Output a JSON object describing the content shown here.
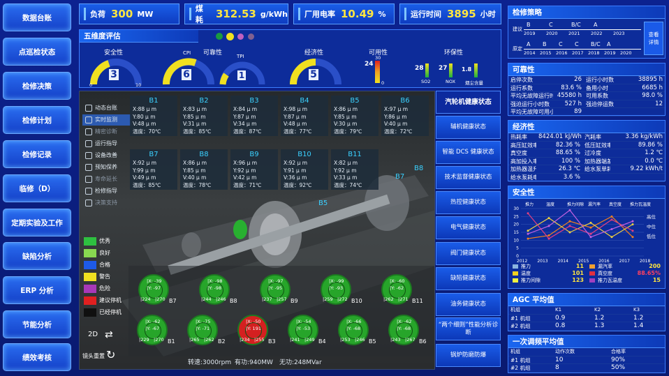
{
  "nav": [
    "数据台账",
    "点巡检状态",
    "检修决策",
    "检修计划",
    "检修记录",
    "临修（D）",
    "定期实验及工作",
    "缺陷分析",
    "ERP 分析",
    "节能分析",
    "绩效考核"
  ],
  "stats": [
    {
      "label": "负荷",
      "value": "300",
      "unit": "MW"
    },
    {
      "label": "煤耗",
      "value": "312.53",
      "unit": "g/kWh"
    },
    {
      "label": "厂用电率",
      "value": "10.49",
      "unit": "%"
    },
    {
      "label": "运行时间",
      "value": "3895",
      "unit": "小时"
    }
  ],
  "five_dim": {
    "title": "五维度评估",
    "safety": "安全性",
    "safety_val": "3",
    "cpi": "CPI",
    "cpi_val": "6",
    "reliab": "可靠性",
    "tpi": "TPI",
    "tpi_val": "1",
    "econ": "经济性",
    "econ_val": "5",
    "avail": "可用性",
    "avail_val": "24",
    "avail_top": "30",
    "avail_bot": "0",
    "env": "环保性",
    "so2_val": "28",
    "so2": "SO2",
    "nox_val": "27",
    "nox": "NOX",
    "dust_val": "1.8",
    "dust": "烟尘含量",
    "g_min": "0",
    "g_max": "10"
  },
  "side_menu": [
    "动态台账",
    "实时监测",
    "精密诊断",
    "运行指导",
    "设备改善",
    "预知保养",
    "寿命延长",
    "检修指导",
    "决策支持"
  ],
  "legend": [
    {
      "label": "优秀",
      "color": "#2ec040"
    },
    {
      "label": "良好",
      "color": "#88d850"
    },
    {
      "label": "合格",
      "color": "#1e5ae8"
    },
    {
      "label": "警告",
      "color": "#f0e020"
    },
    {
      "label": "危险",
      "color": "#a838b8"
    },
    {
      "label": "建议停机",
      "color": "#e02020"
    },
    {
      "label": "已经停机",
      "color": "#101010"
    }
  ],
  "mode": "2D",
  "reset": "镜头重置",
  "bearings": [
    {
      "name": "B1",
      "x": "X:88 μ m",
      "y": "Y:80 μ m",
      "v": "V:48 μ m",
      "t": "温度：70℃"
    },
    {
      "name": "B2",
      "x": "X:83 μ m",
      "y": "Y:85 μ m",
      "v": "V:31 μ m",
      "t": "温度：85℃"
    },
    {
      "name": "B3",
      "x": "X:84 μ m",
      "y": "Y:87 μ m",
      "v": "V:34 μ m",
      "t": "温度：87℃"
    },
    {
      "name": "B4",
      "x": "X:98 μ m",
      "y": "Y:87 μ m",
      "v": "V:48 μ m",
      "t": "温度：77℃"
    },
    {
      "name": "B5",
      "x": "X:86 μ m",
      "y": "Y:85 μ m",
      "v": "V:30 μ m",
      "t": "温度：79℃"
    },
    {
      "name": "B6",
      "x": "X:97 μ m",
      "y": "Y:86 μ m",
      "v": "V:40 μ m",
      "t": "温度：72℃"
    },
    {
      "name": "B7",
      "x": "X:92 μ m",
      "y": "Y:99 μ m",
      "v": "V:49 μ m",
      "t": "温度：85℃"
    },
    {
      "name": "B8",
      "x": "X:86 μ m",
      "y": "Y:85 μ m",
      "v": "V:40 μ m",
      "t": "温度：78℃"
    },
    {
      "name": "B9",
      "x": "X:96 μ m",
      "y": "Y:92 μ m",
      "v": "V:42 μ m",
      "t": "温度：71℃"
    },
    {
      "name": "B10",
      "x": "X:92 μ m",
      "y": "Y:91 μ m",
      "v": "V:36 μ m",
      "t": "温度：92℃"
    },
    {
      "name": "B11",
      "x": "X:82 μ m",
      "y": "Y:92 μ m",
      "v": "V:33 μ m",
      "t": "温度：74℃"
    }
  ],
  "scene_labels": [
    "B5",
    "B7",
    "B8"
  ],
  "gauges": [
    {
      "name": "B7",
      "a": "|X: -39",
      "b": "|Y: -97",
      "c": "|224",
      "d": "|270",
      "color": "#27a52a"
    },
    {
      "name": "B8",
      "a": "|X: -98",
      "b": "|Y: -98",
      "c": "|244",
      "d": "|246",
      "color": "#27a52a"
    },
    {
      "name": "B9",
      "a": "|X: -97",
      "b": "|Y: -95",
      "c": "|237",
      "d": "|257",
      "color": "#27a52a"
    },
    {
      "name": "B10",
      "a": "|X: -99",
      "b": "|Y: -93",
      "c": "|259",
      "d": "|272",
      "color": "#27a52a"
    },
    {
      "name": "B11",
      "a": "|X: -60",
      "b": "|Y: -62",
      "c": "|262",
      "d": "|271",
      "color": "#27a52a"
    },
    {
      "name": "B1",
      "a": "|X: -62",
      "b": "|Y: -67",
      "c": "|229",
      "d": "|270",
      "color": "#27a52a"
    },
    {
      "name": "B2",
      "a": "|X: -75",
      "b": "|Y: -71",
      "c": "|265",
      "d": "|262",
      "color": "#27a52a"
    },
    {
      "name": "B3",
      "a": "|X: -50",
      "b": "|Y: 191",
      "c": "|234",
      "d": "|255",
      "color": "#d42020"
    },
    {
      "name": "B4",
      "a": "|X: -54",
      "b": "|Y: -53",
      "c": "|241",
      "d": "|249",
      "color": "#27a52a"
    },
    {
      "name": "B5",
      "a": "|X: -66",
      "b": "|Y: -68",
      "c": "|253",
      "d": "|246",
      "color": "#27a52a"
    },
    {
      "name": "B6",
      "a": "|X: -62",
      "b": "|Y: -68",
      "c": "|243",
      "d": "|267",
      "color": "#27a52a"
    }
  ],
  "footer": {
    "speed": "转速:3000rpm",
    "active": "有功:940MW",
    "reactive": "无功:248MVar"
  },
  "right_menu": [
    "汽轮机健康状态",
    "辅机健康状态",
    "智能 DCS 健康状态",
    "技术监督健康状态",
    "热控健康状态",
    "电气健康状态",
    "阀门健康状态",
    "缺陷健康状态",
    "油务健康状态",
    "“两个细则”性能分析诊断",
    "锅炉防磨防爆"
  ],
  "strategy": {
    "title": "检修策略",
    "r1_label": "建议",
    "r1_codes": [
      "B",
      "C",
      "B/C",
      "A",
      ""
    ],
    "r1_years": [
      "2019",
      "2020",
      "2021",
      "2022",
      "2023"
    ],
    "r2_label": "原定",
    "r2_codes": [
      "A",
      "B",
      "C",
      "C",
      "B/C",
      "A",
      ""
    ],
    "r2_years": [
      "2014",
      "2015",
      "2016",
      "2017",
      "2018",
      "2019",
      "2020"
    ],
    "btn": "查看详情"
  },
  "reliability": {
    "title": "可靠性",
    "rows": [
      [
        "启停次数",
        "26",
        "运行小时数",
        "38895 h"
      ],
      [
        "运行系数",
        "83.6 %",
        "备用小时",
        "6685 h"
      ],
      [
        "平均无故障运行时间",
        "45580 h",
        "可用系数",
        "98.0 %"
      ],
      [
        "强迫运行小时数",
        "527 h",
        "强迫停运数",
        "12"
      ],
      [
        "平均无故障可用小时",
        "89",
        "",
        ""
      ]
    ]
  },
  "economy": {
    "title": "经济性",
    "rows": [
      [
        "热耗率",
        "8424.01 kJ/Wh",
        "汽耗率",
        "3.36 kg/kWh"
      ],
      [
        "高压缸效率",
        "82.36 %",
        "低压缸效率",
        "89.86 %"
      ],
      [
        "真空度",
        "88.65 %",
        "过冷度",
        "1.2 ℃"
      ],
      [
        "高加投入率",
        "100 %",
        "加热器端差",
        "0.0 ℃"
      ],
      [
        "加热器温升",
        "26.3 ℃",
        "给水泵单耗",
        "9.22 kWh/t"
      ],
      [
        "给水泵耗电率",
        "3.6 %",
        "",
        ""
      ]
    ]
  },
  "safety": {
    "title": "安全性",
    "headers": [
      "推力",
      "温度",
      "推力间隙",
      "漏汽率",
      "真空度",
      "推力瓦温度"
    ],
    "bars": [
      {
        "name": "推力",
        "values": [
          11,
          13,
          22,
          18,
          25,
          12
        ]
      },
      {
        "name": "温度",
        "values": [
          16,
          24,
          15,
          21,
          12,
          20
        ]
      },
      {
        "name": "推力间隙",
        "values": [
          27,
          11,
          19,
          14,
          23,
          16
        ]
      },
      {
        "name": "真空度",
        "values": [
          14,
          19,
          29,
          12,
          17,
          22
        ]
      }
    ],
    "levels": [
      "高位",
      "中位",
      "低位"
    ],
    "yticks": [
      "30",
      "25",
      "20",
      "15",
      "10",
      "5",
      "0"
    ],
    "years": [
      "2012",
      "2013",
      "2014",
      "2015",
      "2016",
      "2017",
      "2018"
    ],
    "legend": [
      {
        "name": "推力",
        "value": "11",
        "color": "#8ab4e0"
      },
      {
        "name": "漏汽率",
        "value": "200",
        "color": "#f0a030"
      },
      {
        "name": "温度",
        "value": "101",
        "color": "#f0d020"
      },
      {
        "name": "真空度",
        "value": "88.65%",
        "color": "#e03040"
      },
      {
        "name": "推力间隙",
        "value": "123",
        "color": "#f0f040"
      },
      {
        "name": "推力瓦温度",
        "value": "15",
        "color": "#a040c0"
      }
    ]
  },
  "agc": {
    "title": "AGC 平均值",
    "headers": [
      "机组",
      "K1",
      "K2",
      "K3"
    ],
    "rows": [
      [
        "#1 机组",
        "0.9",
        "1.2",
        "1.2"
      ],
      [
        "#2 机组",
        "0.8",
        "1.3",
        "1.4"
      ]
    ]
  },
  "freq": {
    "title": "一次调频平均值",
    "headers": [
      "机组",
      "动作次数",
      "合格率"
    ],
    "rows": [
      [
        "#1 机组",
        "10",
        "90%"
      ],
      [
        "#2 机组",
        "8",
        "50%"
      ]
    ]
  },
  "colors": {
    "accent": "#ffe640",
    "ok": "#27a52a",
    "danger": "#d42020"
  }
}
